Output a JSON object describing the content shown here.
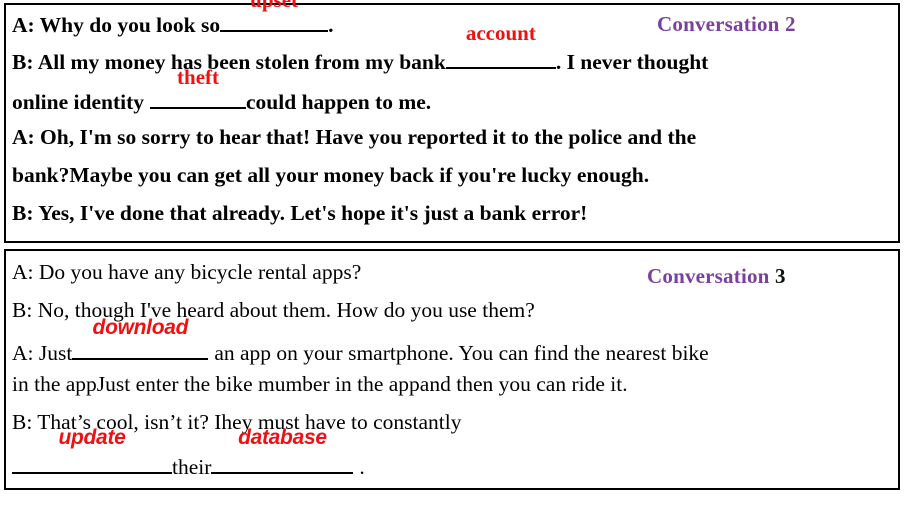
{
  "document": {
    "type": "english-worksheet-fill-in-the-blank",
    "background_color": "#ffffff",
    "border_color": "#000000",
    "answer_color": "#ee1111",
    "label_color": "#7B3FA0"
  },
  "conversations": [
    {
      "label_text": "Conversation",
      "label_number": "2",
      "lines": [
        {
          "segments": [
            {
              "kind": "text",
              "text": "A: Why do you look so"
            },
            {
              "kind": "blank",
              "answer": "upset"
            },
            {
              "kind": "text",
              "text": "."
            }
          ]
        },
        {
          "segments": [
            {
              "kind": "text",
              "text": "B: All my money has been stolen from my bank"
            },
            {
              "kind": "blank",
              "answer": "account"
            },
            {
              "kind": "text",
              "text": ". I never thought"
            }
          ]
        },
        {
          "segments": [
            {
              "kind": "text",
              "text": "online identity"
            },
            {
              "kind": "blank",
              "answer": "theft"
            },
            {
              "kind": "text",
              "text": "could happen to me."
            }
          ]
        },
        {
          "segments": [
            {
              "kind": "text",
              "text": "A: Oh, I'm so sorry to hear that! Have you reported it to the police and the"
            }
          ]
        },
        {
          "segments": [
            {
              "kind": "text",
              "text": "bank?Maybe you can get all your money back if you're lucky enough."
            }
          ]
        },
        {
          "segments": [
            {
              "kind": "text",
              "text": "B: Yes, I've done that already. Let's hope it's just a bank error!"
            }
          ]
        }
      ]
    },
    {
      "label_text": "Conversation",
      "label_number": "3",
      "lines": [
        {
          "segments": [
            {
              "kind": "text",
              "text": "A: Do you have any bicycle rental apps?"
            }
          ]
        },
        {
          "segments": [
            {
              "kind": "text",
              "text": "B: No, though I've heard about them. How do you use them?"
            }
          ]
        },
        {
          "segments": [
            {
              "kind": "text",
              "text": "A: Just"
            },
            {
              "kind": "blank",
              "answer": "download"
            },
            {
              "kind": "text",
              "text": "an app on your smartphone. You can find the nearest bike"
            }
          ]
        },
        {
          "segments": [
            {
              "kind": "text",
              "text": "in the appJust enter the bike mumber in the appand then you can ride it."
            }
          ]
        },
        {
          "segments": [
            {
              "kind": "text",
              "text": "B: That’s cool, isn’t it? Ihey must have to constantly"
            }
          ]
        },
        {
          "segments": [
            {
              "kind": "blank",
              "answer": "update"
            },
            {
              "kind": "text",
              "text": "their"
            },
            {
              "kind": "blank",
              "answer": "database"
            },
            {
              "kind": "text",
              "text": "."
            }
          ]
        }
      ]
    }
  ],
  "answers": {
    "upset": "upset",
    "account": "account",
    "theft": "theft",
    "download": "download",
    "update": "update",
    "database": "database"
  },
  "b1": {
    "l1_a": "A: Why do you look so",
    "l1_b": ".",
    "l2_a": "B: All my money has been stolen from my bank",
    "l2_b": ". I never thought",
    "l3_a": "online identity",
    "l3_b": "could happen to me.",
    "l4": "A: Oh, I'm so sorry to hear that! Have you reported it to the police and the",
    "l5": "bank?Maybe you can get all your money back if you're lucky enough.",
    "l6": "B: Yes, I've done that already. Let's hope it's just a bank error!"
  },
  "b2": {
    "l1": "A: Do you have any bicycle rental apps?",
    "l2": "B: No, though I've heard about them. How do you use them?",
    "l3_a": "A: Just",
    "l3_b": "an app on your smartphone. You can find the nearest bike",
    "l4": "in the appJust enter the bike mumber in the appand then you can ride it.",
    "l5": "B: That’s cool, isn’t it? Ihey must have to constantly",
    "l6_a": "their",
    "l6_b": "."
  },
  "labels": {
    "conv2_text": "Conversation",
    "conv2_num": "2",
    "conv3_text": "Conversation",
    "conv3_num": "3"
  }
}
